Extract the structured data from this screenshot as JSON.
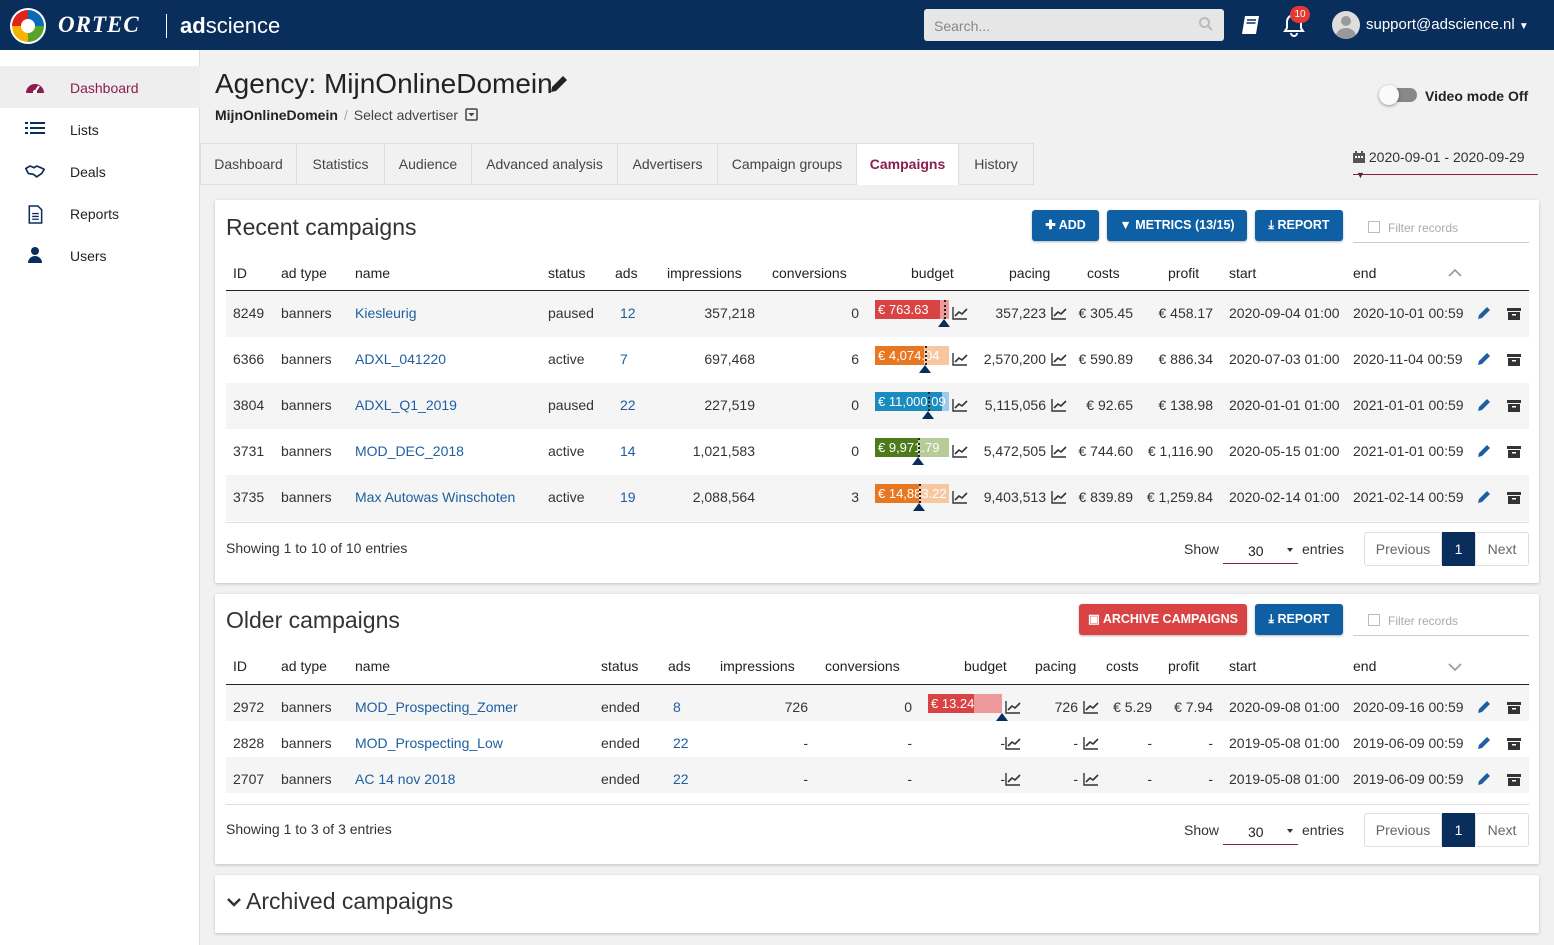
{
  "header": {
    "brand": "ORTEC",
    "product_prefix": "ad",
    "product_suffix": "science",
    "search_placeholder": "Search...",
    "notification_count": "10",
    "user": "support@adscience.nl"
  },
  "sidebar": {
    "items": [
      {
        "label": "Dashboard",
        "icon": "dashboard-icon"
      },
      {
        "label": "Lists",
        "icon": "list-icon"
      },
      {
        "label": "Deals",
        "icon": "handshake-icon"
      },
      {
        "label": "Reports",
        "icon": "report-icon"
      },
      {
        "label": "Users",
        "icon": "user-icon"
      }
    ]
  },
  "page": {
    "title": "Agency: MijnOnlineDomein",
    "breadcrumb_agency": "MijnOnlineDomein",
    "breadcrumb_select": "Select advertiser",
    "video_mode": "Video mode Off",
    "date_range": "2020-09-01 - 2020-09-29"
  },
  "tabs": [
    "Dashboard",
    "Statistics",
    "Audience",
    "Advanced analysis",
    "Advertisers",
    "Campaign groups",
    "Campaigns",
    "History"
  ],
  "columns": [
    "ID",
    "ad type",
    "name",
    "status",
    "ads",
    "impressions",
    "conversions",
    "budget",
    "pacing",
    "costs",
    "profit",
    "start",
    "end"
  ],
  "recent": {
    "title": "Recent campaigns",
    "add": "ADD",
    "metrics": "METRICS (13/15)",
    "report": "REPORT",
    "filter": "Filter records",
    "rows": [
      {
        "id": "8249",
        "type": "banners",
        "name": "Kiesleurig",
        "status": "paused",
        "ads": "12",
        "impressions": "357,218",
        "conversions": "0",
        "budget": "€ 763.63",
        "budget_color": "#d94343",
        "budget_light": "#ef9a9a",
        "spend_fraction": 0.88,
        "pacing_fraction": 0.93,
        "pacing": "357,223",
        "costs": "€ 305.45",
        "profit": "€ 458.17",
        "start": "2020-09-04 01:00",
        "end": "2020-10-01 00:59"
      },
      {
        "id": "6366",
        "type": "banners",
        "name": "ADXL_041220",
        "status": "active",
        "ads": "7",
        "impressions": "697,468",
        "conversions": "6",
        "budget": "€ 4,074.04",
        "budget_color": "#e87722",
        "budget_light": "#f7c7a0",
        "spend_fraction": 0.66,
        "pacing_fraction": 0.68,
        "pacing": "2,570,200",
        "costs": "€ 590.89",
        "profit": "€ 886.34",
        "start": "2020-07-03 01:00",
        "end": "2020-11-04 00:59"
      },
      {
        "id": "3804",
        "type": "banners",
        "name": "ADXL_Q1_2019",
        "status": "paused",
        "ads": "22",
        "impressions": "227,519",
        "conversions": "0",
        "budget": "€ 11,000.09",
        "budget_color": "#1a8cc0",
        "budget_light": "#9ecbe6",
        "spend_fraction": 0.9,
        "pacing_fraction": 0.71,
        "pacing": "5,115,056",
        "costs": "€ 92.65",
        "profit": "€ 138.98",
        "start": "2020-01-01 01:00",
        "end": "2021-01-01 00:59"
      },
      {
        "id": "3731",
        "type": "banners",
        "name": "MOD_DEC_2018",
        "status": "active",
        "ads": "14",
        "impressions": "1,021,583",
        "conversions": "0",
        "budget": "€ 9,971.79",
        "budget_color": "#4f7a1c",
        "budget_light": "#b8cc99",
        "spend_fraction": 0.58,
        "pacing_fraction": 0.58,
        "pacing": "5,472,505",
        "costs": "€ 744.60",
        "profit": "€ 1,116.90",
        "start": "2020-05-15 01:00",
        "end": "2021-01-01 00:59"
      },
      {
        "id": "3735",
        "type": "banners",
        "name": "Max Autowas Winschoten",
        "status": "active",
        "ads": "19",
        "impressions": "2,088,564",
        "conversions": "3",
        "budget": "€ 14,883.22",
        "budget_color": "#e87722",
        "budget_light": "#f7c7a0",
        "spend_fraction": 0.6,
        "pacing_fraction": 0.6,
        "pacing": "9,403,513",
        "costs": "€ 839.89",
        "profit": "€ 1,259.84",
        "start": "2020-02-14 01:00",
        "end": "2021-02-14 00:59"
      }
    ],
    "showing": "Showing 1 to 10 of 10 entries"
  },
  "older": {
    "title": "Older campaigns",
    "archive": "ARCHIVE CAMPAIGNS",
    "report": "REPORT",
    "filter": "Filter records",
    "rows": [
      {
        "id": "2972",
        "type": "banners",
        "name": "MOD_Prospecting_Zomer",
        "status": "ended",
        "ads": "8",
        "impressions": "726",
        "conversions": "0",
        "budget": "€ 13.24",
        "budget_color": "#d94343",
        "budget_light": "#ef9a9a",
        "spend_fraction": 0.62,
        "pacing_fraction": 1.0,
        "pacing": "726",
        "costs": "€ 5.29",
        "profit": "€ 7.94",
        "start": "2020-09-08 01:00",
        "end": "2020-09-16 00:59"
      },
      {
        "id": "2828",
        "type": "banners",
        "name": "MOD_Prospecting_Low",
        "status": "ended",
        "ads": "22",
        "impressions": "-",
        "conversions": "-",
        "budget": "-",
        "pacing": "-",
        "costs": "-",
        "profit": "-",
        "start": "2019-05-08 01:00",
        "end": "2019-06-09 00:59"
      },
      {
        "id": "2707",
        "type": "banners",
        "name": "AC 14 nov 2018",
        "status": "ended",
        "ads": "22",
        "impressions": "-",
        "conversions": "-",
        "budget": "-",
        "pacing": "-",
        "costs": "-",
        "profit": "-",
        "start": "2019-05-08 01:00",
        "end": "2019-06-09 00:59"
      }
    ],
    "showing": "Showing 1 to 3 of 3 entries"
  },
  "pagination": {
    "show": "Show",
    "entries": "entries",
    "per_page": "30",
    "previous": "Previous",
    "page": "1",
    "next": "Next"
  },
  "archived": {
    "title": "Archived campaigns"
  },
  "colors": {
    "navy": "#0a2e5c",
    "accent": "#8b1d4f",
    "link": "#1e5fa0",
    "blue_button": "#0e5fa3",
    "red_button": "#d94343"
  }
}
